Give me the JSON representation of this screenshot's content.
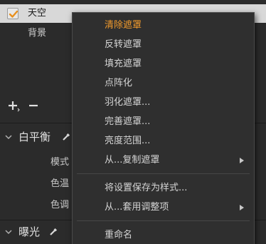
{
  "masks": {
    "items": [
      {
        "label": "天空",
        "checked": true,
        "selected": true
      },
      {
        "label": "背景",
        "checked": false,
        "selected": false
      }
    ]
  },
  "mask_toolbar": {
    "add_icon": "plus-icon",
    "remove_icon": "minus-icon"
  },
  "white_balance": {
    "title": "白平衡",
    "params": [
      "模式",
      "色温",
      "色调"
    ]
  },
  "exposure": {
    "title": "曝光"
  },
  "context_menu": {
    "items": [
      {
        "label": "清除遮罩",
        "highlight": true
      },
      {
        "label": "反转遮罩"
      },
      {
        "label": "填充遮罩"
      },
      {
        "label": "点阵化"
      },
      {
        "label": "羽化遮罩..."
      },
      {
        "label": "完善遮罩..."
      },
      {
        "label": "亮度范围..."
      },
      {
        "label": "从...复制遮罩",
        "submenu": true
      },
      {
        "label": "将设置保存为样式..."
      },
      {
        "label": "从...套用调整项",
        "submenu": true
      },
      {
        "label": "重命名"
      }
    ]
  },
  "colors": {
    "accent": "#f09a2c",
    "checkbox_mark": "#e8901e",
    "menu_bg": "#2f2f2f",
    "panel_bg": "#2b2b2b"
  }
}
